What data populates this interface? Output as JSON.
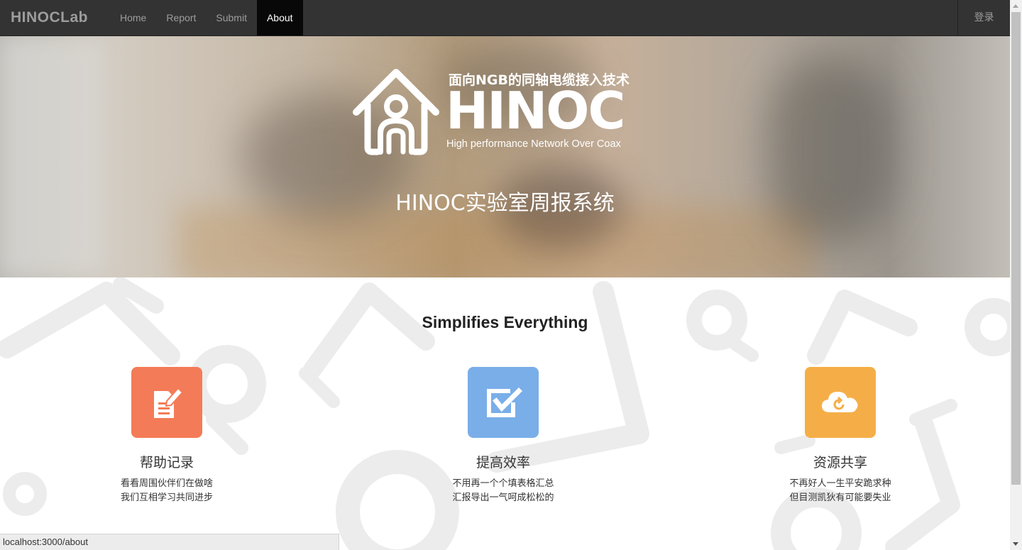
{
  "navbar": {
    "brand": "HINOCLab",
    "links": [
      "Home",
      "Report",
      "Submit",
      "About"
    ],
    "active": "About",
    "login": "登录"
  },
  "hero": {
    "logo_tagline": "面向NGB的同轴电缆接入技术",
    "logo_word": "HINOC",
    "logo_subtitle": "High performance Network Over Coax",
    "title": "HINOC实验室周报系统"
  },
  "features": {
    "title": "Simplifies Everything",
    "items": [
      {
        "title": "帮助记录",
        "lines": [
          "看看周围伙伴们在做啥",
          "我们互相学习共同进步"
        ],
        "color": "#f47b57",
        "icon": "edit-document-icon"
      },
      {
        "title": "提高效率",
        "lines": [
          "不用再一个个填表格汇总",
          "汇报导出一气呵成松松的"
        ],
        "color": "#7aaee8",
        "icon": "checkbox-icon"
      },
      {
        "title": "资源共享",
        "lines": [
          "不再好人一生平安跪求种",
          "但目测凯狄有可能要失业"
        ],
        "color": "#f5ae47",
        "icon": "cloud-sync-icon"
      }
    ]
  },
  "statusbar": {
    "url": "localhost:3000/about"
  }
}
